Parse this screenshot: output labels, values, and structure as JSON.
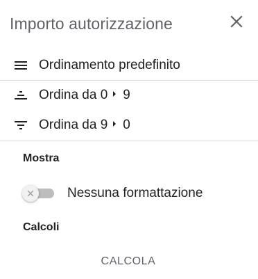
{
  "header": {
    "title": "Importo autorizzazione",
    "close_icon": "close-icon"
  },
  "sort_options": [
    {
      "label": "Ordinamento predefinito",
      "icon": "menu-lines-icon"
    },
    {
      "from": "Ordina da 0",
      "to": "9",
      "icon": "sort-ascending-icon"
    },
    {
      "from": "Ordina da 9",
      "to": "0",
      "icon": "sort-descending-icon"
    }
  ],
  "display_section": {
    "title": "Mostra",
    "toggle_label": "Nessuna formattazione",
    "toggle_on": false
  },
  "calc_section": {
    "title": "Calcoli",
    "button_label": "CALCOLA"
  },
  "colors": {
    "text": "#202124",
    "muted": "#5f6368",
    "divider": "#dadce0"
  }
}
